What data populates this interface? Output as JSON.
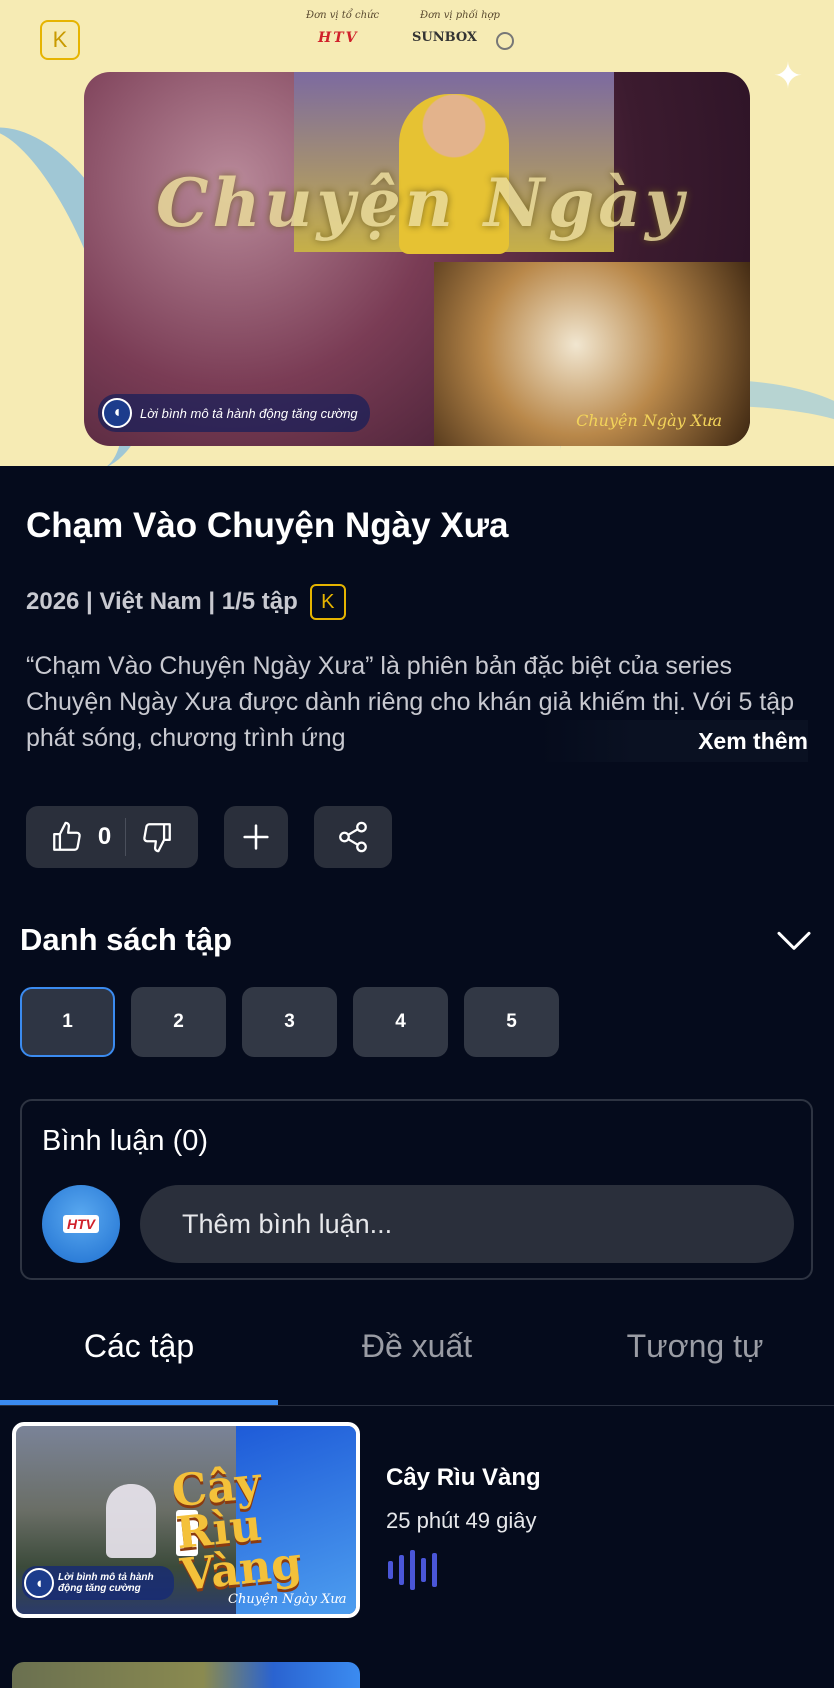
{
  "banner": {
    "rating_badge": "K",
    "organizer_label": "Đơn vị tổ chức",
    "partner_label": "Đơn vị phối hợp",
    "organizer_logo": "HTV",
    "partner_logo": "SUNBOX",
    "poster_title_art": "Chuyện Ngày",
    "poster_caption": "Lời bình mô tả hành động tăng cường",
    "poster_brand": "Chuyện Ngày Xưa"
  },
  "show": {
    "title": "Chạm Vào Chuyện Ngày Xưa",
    "meta": "2026 | Việt Nam | 1/5 tập",
    "rating": "K",
    "description": "“Chạm Vào Chuyện Ngày Xưa” là phiên bản đặc biệt của series Chuyện Ngày Xưa được dành riêng cho khán giả khiếm thị. Với 5 tập phát sóng, chương trình ứng",
    "see_more": "Xem thêm"
  },
  "actions": {
    "like_count": "0"
  },
  "episodes_section": {
    "title": "Danh sách tập",
    "episodes": [
      "1",
      "2",
      "3",
      "4",
      "5"
    ],
    "active_episode": "1"
  },
  "comments": {
    "title": "Bình luận (0)",
    "avatar_text": "HTV",
    "placeholder": "Thêm bình luận..."
  },
  "tabs": [
    "Các tập",
    "Đề xuất",
    "Tương tự"
  ],
  "episode_list": [
    {
      "thumb_title": "Cây Rìu Vàng",
      "thumb_caption": "Lời bình mô tả hành động tăng cường",
      "thumb_brand": "Chuyện Ngày Xưa",
      "title": "Cây Rìu Vàng",
      "duration": "25 phút 49 giây"
    }
  ],
  "colors": {
    "background": "#050b1c",
    "accent": "#3b8bf0",
    "rating_badge": "#e6b400",
    "now_playing": "#4a56d8"
  }
}
